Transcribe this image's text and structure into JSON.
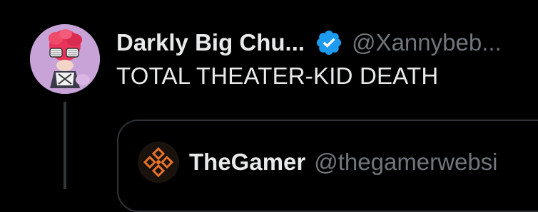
{
  "tweet": {
    "author": {
      "display_name": "Darkly Big Chu...",
      "handle": "@Xannybeb...",
      "verified": true,
      "avatar_icon": "pink-haired-character-avatar"
    },
    "text": "TOTAL THEATER-KID DEATH",
    "quoted": {
      "display_name": "TheGamer",
      "handle": "@thegamerwebsi",
      "avatar_icon": "thegamer-logo"
    }
  },
  "colors": {
    "background": "#000000",
    "primary_text": "#e7e9ea",
    "secondary_text": "#71767b",
    "verified_badge": "#1d9bf0",
    "border": "#2f3336",
    "brand_orange": "#e8732a"
  }
}
